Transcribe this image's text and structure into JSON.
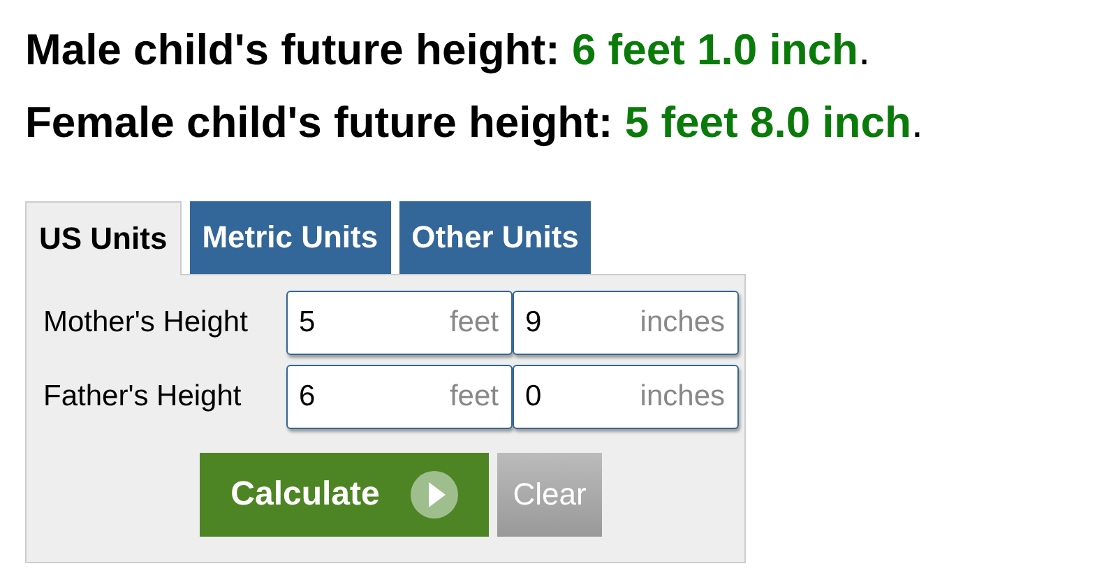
{
  "results": [
    {
      "label": "Male child's future height: ",
      "value": "6 feet 1.0 inch",
      "end": "."
    },
    {
      "label": "Female child's future height: ",
      "value": "5 feet 8.0 inch",
      "end": "."
    }
  ],
  "tabs": [
    {
      "label": "US Units",
      "selected": true
    },
    {
      "label": "Metric Units",
      "selected": false
    },
    {
      "label": "Other Units",
      "selected": false
    }
  ],
  "rows": [
    {
      "label": "Mother's Height",
      "fields": [
        {
          "value": "5",
          "unit": "feet"
        },
        {
          "value": "9",
          "unit": "inches"
        }
      ]
    },
    {
      "label": "Father's Height",
      "fields": [
        {
          "value": "6",
          "unit": "feet"
        },
        {
          "value": "0",
          "unit": "inches"
        }
      ]
    }
  ],
  "buttons": {
    "calculate": "Calculate",
    "clear": "Clear"
  }
}
